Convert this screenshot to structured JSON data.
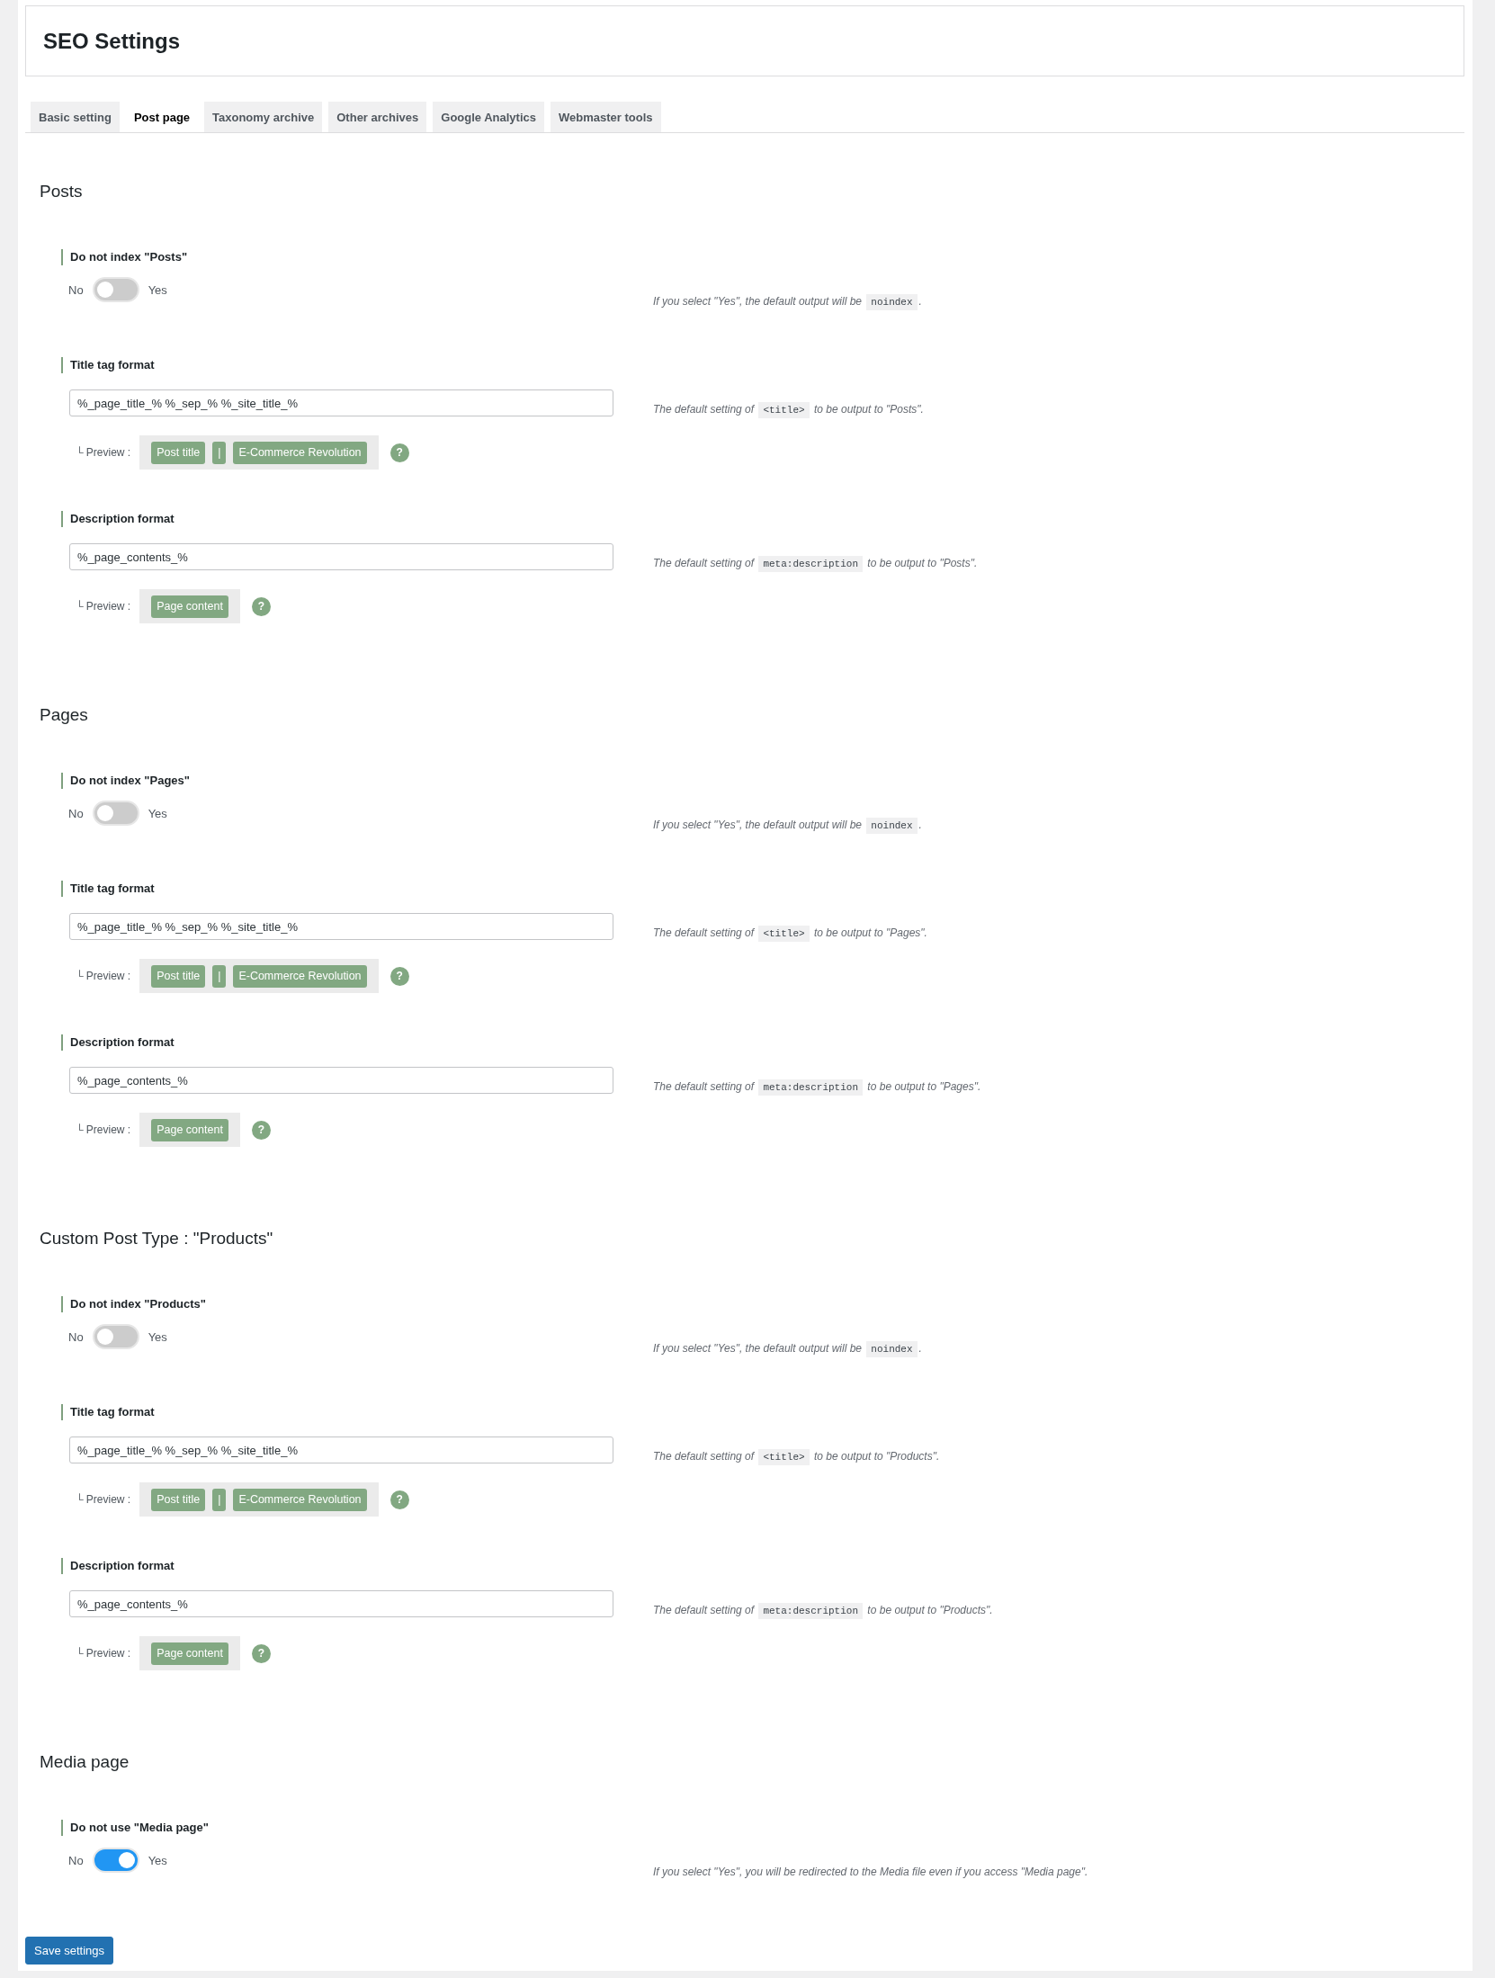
{
  "header": {
    "title": "SEO Settings"
  },
  "tabs": [
    {
      "label": "Basic setting",
      "selected": false
    },
    {
      "label": "Post page",
      "selected": true
    },
    {
      "label": "Taxonomy archive",
      "selected": false
    },
    {
      "label": "Other archives",
      "selected": false
    },
    {
      "label": "Google Analytics",
      "selected": false
    },
    {
      "label": "Webmaster tools",
      "selected": false
    }
  ],
  "sections": [
    {
      "heading": "Posts",
      "fields": [
        {
          "kind": "toggle",
          "label": "Do not index \"Posts\"",
          "off_label": "No",
          "on_label": "Yes",
          "on": false,
          "help": [
            {
              "kind": "text",
              "text": "If you select \"Yes\", the default output will be "
            },
            {
              "kind": "code",
              "text": "noindex"
            },
            {
              "kind": "text",
              "text": "."
            }
          ]
        },
        {
          "kind": "format",
          "label": "Title tag format",
          "value": "%_page_title_% %_sep_% %_site_title_%",
          "preview_label": "└ Preview :",
          "preview_tags": [
            "Post title",
            "|",
            "E-Commerce Revolution"
          ],
          "help_icon": "?",
          "help": [
            {
              "kind": "text",
              "text": "The default setting of "
            },
            {
              "kind": "code",
              "text": "<title>"
            },
            {
              "kind": "text",
              "text": " to be output to \"Posts\"."
            }
          ]
        },
        {
          "kind": "format",
          "label": "Description format",
          "value": "%_page_contents_%",
          "preview_label": "└ Preview :",
          "preview_tags": [
            "Page content"
          ],
          "help_icon": "?",
          "help": [
            {
              "kind": "text",
              "text": "The default setting of "
            },
            {
              "kind": "code",
              "text": "meta:description"
            },
            {
              "kind": "text",
              "text": " to be output to \"Posts\"."
            }
          ]
        }
      ]
    },
    {
      "heading": "Pages",
      "fields": [
        {
          "kind": "toggle",
          "label": "Do not index \"Pages\"",
          "off_label": "No",
          "on_label": "Yes",
          "on": false,
          "help": [
            {
              "kind": "text",
              "text": "If you select \"Yes\", the default output will be "
            },
            {
              "kind": "code",
              "text": "noindex"
            },
            {
              "kind": "text",
              "text": "."
            }
          ]
        },
        {
          "kind": "format",
          "label": "Title tag format",
          "value": "%_page_title_% %_sep_% %_site_title_%",
          "preview_label": "└ Preview :",
          "preview_tags": [
            "Post title",
            "|",
            "E-Commerce Revolution"
          ],
          "help_icon": "?",
          "help": [
            {
              "kind": "text",
              "text": "The default setting of "
            },
            {
              "kind": "code",
              "text": "<title>"
            },
            {
              "kind": "text",
              "text": " to be output to \"Pages\"."
            }
          ]
        },
        {
          "kind": "format",
          "label": "Description format",
          "value": "%_page_contents_%",
          "preview_label": "└ Preview :",
          "preview_tags": [
            "Page content"
          ],
          "help_icon": "?",
          "help": [
            {
              "kind": "text",
              "text": "The default setting of "
            },
            {
              "kind": "code",
              "text": "meta:description"
            },
            {
              "kind": "text",
              "text": " to be output to \"Pages\"."
            }
          ]
        }
      ]
    },
    {
      "heading": "Custom Post Type : \"Products\"",
      "fields": [
        {
          "kind": "toggle",
          "label": "Do not index \"Products\"",
          "off_label": "No",
          "on_label": "Yes",
          "on": false,
          "help": [
            {
              "kind": "text",
              "text": "If you select \"Yes\", the default output will be "
            },
            {
              "kind": "code",
              "text": "noindex"
            },
            {
              "kind": "text",
              "text": "."
            }
          ]
        },
        {
          "kind": "format",
          "label": "Title tag format",
          "value": "%_page_title_% %_sep_% %_site_title_%",
          "preview_label": "└ Preview :",
          "preview_tags": [
            "Post title",
            "|",
            "E-Commerce Revolution"
          ],
          "help_icon": "?",
          "help": [
            {
              "kind": "text",
              "text": "The default setting of "
            },
            {
              "kind": "code",
              "text": "<title>"
            },
            {
              "kind": "text",
              "text": " to be output to \"Products\"."
            }
          ]
        },
        {
          "kind": "format",
          "label": "Description format",
          "value": "%_page_contents_%",
          "preview_label": "└ Preview :",
          "preview_tags": [
            "Page content"
          ],
          "help_icon": "?",
          "help": [
            {
              "kind": "text",
              "text": "The default setting of "
            },
            {
              "kind": "code",
              "text": "meta:description"
            },
            {
              "kind": "text",
              "text": " to be output to \"Products\"."
            }
          ]
        }
      ]
    },
    {
      "heading": "Media page",
      "fields": [
        {
          "kind": "toggle",
          "label": "Do not use \"Media page\"",
          "off_label": "No",
          "on_label": "Yes",
          "on": true,
          "help": [
            {
              "kind": "text",
              "text": "If you select \"Yes\", you will be redirected to the Media file even if you access \"Media page\"."
            }
          ]
        }
      ]
    }
  ],
  "save_button": "Save settings"
}
